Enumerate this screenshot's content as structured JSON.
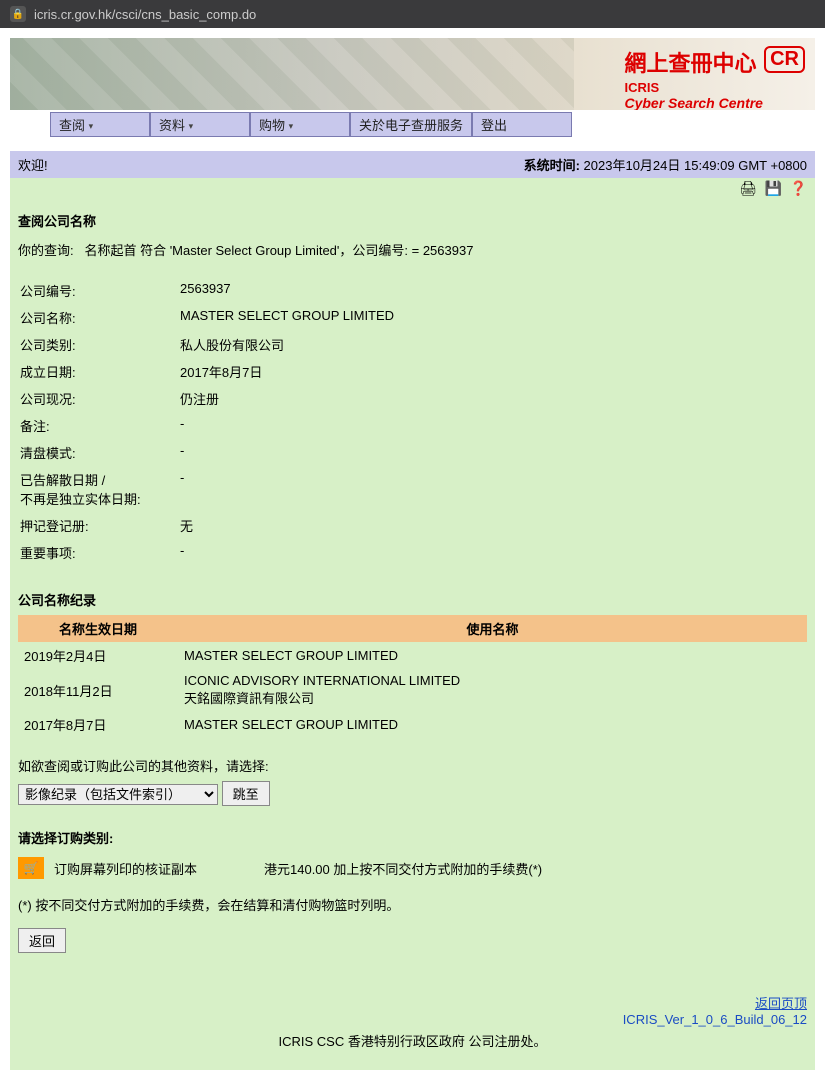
{
  "browser": {
    "url": "icris.cr.gov.hk/csci/cns_basic_comp.do"
  },
  "banner": {
    "title_cn": "網上查冊中心",
    "badge": "CR",
    "sub1": "ICRIS",
    "sub2": "Cyber Search Centre"
  },
  "nav": {
    "items": [
      {
        "label": "查阅",
        "has_arrow": true
      },
      {
        "label": "资料",
        "has_arrow": true
      },
      {
        "label": "购物",
        "has_arrow": true
      },
      {
        "label": "关於电子查册服务",
        "has_arrow": false
      },
      {
        "label": "登出",
        "has_arrow": false
      }
    ]
  },
  "welcome": {
    "greeting": "欢迎!",
    "systime_label": "系统时间:",
    "systime_value": "2023年10月24日 15:49:09 GMT +0800"
  },
  "section": {
    "search_title": "查阅公司名称",
    "query_prefix": "你的查询:",
    "query_text": "名称起首 符合 'Master Select Group Limited'，公司编号:   = 2563937"
  },
  "company": {
    "rows": [
      {
        "label": "公司编号:",
        "value": "2563937"
      },
      {
        "label": "公司名称:",
        "value": "MASTER SELECT GROUP LIMITED"
      },
      {
        "label": "公司类别:",
        "value": "私人股份有限公司"
      },
      {
        "label": "成立日期:",
        "value": "2017年8月7日"
      },
      {
        "label": "公司现况:",
        "value": "仍注册"
      },
      {
        "label": "备注:",
        "value": "-"
      },
      {
        "label": "清盘模式:",
        "value": "-"
      },
      {
        "label": "已告解散日期 /\n不再是独立实体日期:",
        "value": "-"
      },
      {
        "label": "押记登记册:",
        "value": "无"
      },
      {
        "label": "重要事项:",
        "value": "-"
      }
    ]
  },
  "history": {
    "title": "公司名称纪录",
    "col1": "名称生效日期",
    "col2": "使用名称",
    "rows": [
      {
        "date": "2019年2月4日",
        "name": "MASTER SELECT GROUP LIMITED"
      },
      {
        "date": "2018年11月2日",
        "name": "ICONIC ADVISORY INTERNATIONAL LIMITED\n天銘國際資訊有限公司"
      },
      {
        "date": "2017年8月7日",
        "name": "MASTER SELECT GROUP LIMITED"
      }
    ]
  },
  "other_docs": {
    "prompt": "如欲查阅或订购此公司的其他资料，请选择:",
    "select_value": "影像纪录（包括文件索引）",
    "go_btn": "跳至"
  },
  "order": {
    "title": "请选择订购类别:",
    "item_label": "订购屏幕列印的核证副本",
    "item_price": "港元140.00 加上按不同交付方式附加的手续费(*)",
    "note": "(*) 按不同交付方式附加的手续费，会在结算和清付购物篮时列明。",
    "back_btn": "返回"
  },
  "footer": {
    "top_link": "返回页顶",
    "version": "ICRIS_Ver_1_0_6_Build_06_12",
    "copyright": "ICRIS CSC 香港特别行政区政府 公司注册处。"
  }
}
